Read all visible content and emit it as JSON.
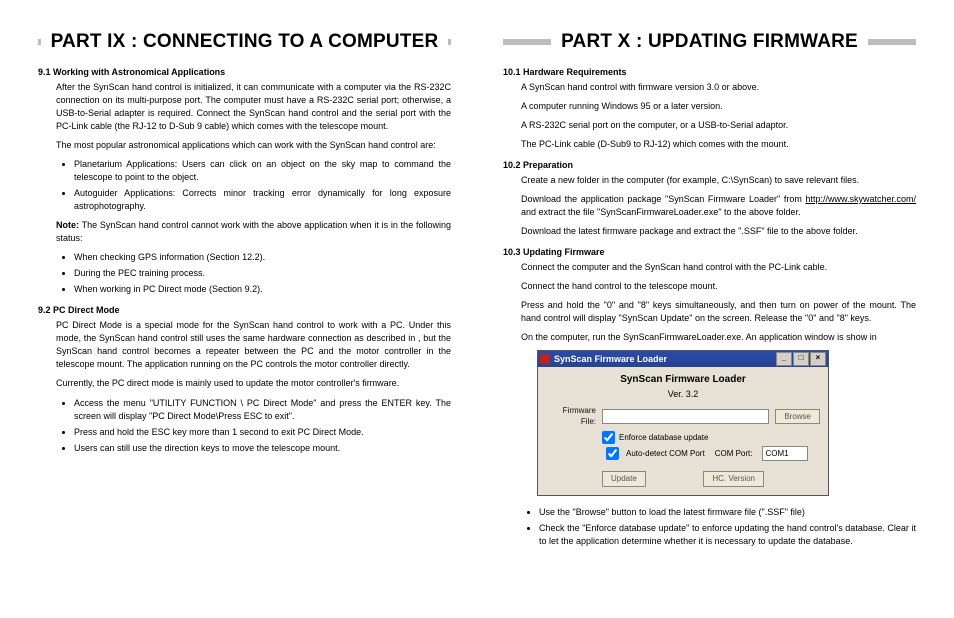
{
  "left": {
    "part_title": "PART IX : CONNECTING TO A COMPUTER",
    "s91_head": "9.1 Working with Astronomical Applications",
    "s91_p1": "After the SynScan hand control is initialized, it can communicate with a computer via the RS-232C connection on its multi-purpose port. The computer must have a RS-232C serial port; otherwise, a USB-to-Serial adapter is required. Connect the SynScan hand control and the serial port with the PC-Link cable (the RJ-12 to D-Sub 9 cable) which comes with the telescope mount.",
    "s91_p2": "The most popular astronomical applications which can work with the SynScan hand control are:",
    "s91_b1": "Planetarium Applications: Users can click on an object on the sky map to command the telescope to point to the object.",
    "s91_b2": "Autoguider Applications: Corrects minor tracking error dynamically for long exposure astrophotography.",
    "s91_note_label": "Note:",
    "s91_note": " The SynScan hand control cannot work with the above application when it is in the following status:",
    "s91_n1": "When checking GPS information (Section 12.2).",
    "s91_n2": "During the PEC training process.",
    "s91_n3": "When working in PC Direct mode (Section 9.2).",
    "s92_head": "9.2 PC Direct Mode",
    "s92_p1_a": "PC Direct Mode is a special mode for the SynScan hand control to work with a PC. Under this mode, the SynScan hand control still uses the same hardware connection as described in ",
    "s92_p1_b": ", but the SynScan hand control becomes a repeater between the PC and the motor controller in the telescope mount. The application running on the PC controls the motor controller directly.",
    "s92_p2": "Currently, the PC direct mode is mainly used to update the motor controller's firmware.",
    "s92_b1_a": "Access the menu \"",
    "s92_b1_path": "UTILITY FUNCTION \\ PC Direct Mode",
    "s92_b1_b": "\" and press the ",
    "s92_b1_enter": "ENTER",
    "s92_b1_c": " key. The screen will display \"",
    "s92_b1_msg": "PC Direct Mode\\Press ESC to exit",
    "s92_b1_d": "\".",
    "s92_b2_a": "Press and hold the ",
    "s92_b2_esc": "ESC",
    "s92_b2_b": " key more than 1 second to exit ",
    "s92_b2_mode": "PC Direct Mode",
    "s92_b2_c": ".",
    "s92_b3": "Users can still use the direction keys to move the telescope mount."
  },
  "right": {
    "part_title": "PART X : UPDATING FIRMWARE",
    "s101_head": "10.1 Hardware Requirements",
    "s101_l1": "A SynScan hand control with firmware version 3.0 or above.",
    "s101_l2": "A computer running Windows 95 or a later version.",
    "s101_l3": "A RS-232C serial port on the computer, or a USB-to-Serial adaptor.",
    "s101_l4": "The PC-Link cable (D-Sub9 to RJ-12) which comes with the mount.",
    "s102_head": "10.2 Preparation",
    "s102_l1_a": "Create a new folder in the computer (for example, ",
    "s102_l1_path": "C:\\SynScan",
    "s102_l1_b": ") to save relevant files.",
    "s102_l2_a": "Download the application package \"",
    "s102_l2_pkg": "SynScan Firmware Loader",
    "s102_l2_b": "\" from ",
    "s102_l2_url": "http://www.skywatcher.com/",
    "s102_l2_c": " and extract the file \"",
    "s102_l2_exe": "SynScanFirmwareLoader.exe",
    "s102_l2_d": "\" to the above folder.",
    "s102_l3_a": "Download the latest firmware package and extract the \".",
    "s102_l3_ssf": "SSF",
    "s102_l3_b": "\" file to the above folder.",
    "s103_head": "10.3 Updating Firmware",
    "s103_l1": "Connect the computer and the SynScan hand control with the PC-Link cable.",
    "s103_l2": "Connect the hand control to the telescope mount.",
    "s103_l3_a": "Press and hold the \"",
    "s103_l3_0": "0",
    "s103_l3_b": "\" and \"",
    "s103_l3_8": "8",
    "s103_l3_c": "\" keys simultaneously, and then turn on power of the mount. The hand control will display \"",
    "s103_l3_upd": "SynScan Update",
    "s103_l3_d": "\" on the screen. Release the \"",
    "s103_l3_e": "\" and \"",
    "s103_l3_f": "\" keys.",
    "s103_l4_a": "On the computer, run the ",
    "s103_l4_exe": "SynScanFirmwareLoader.exe",
    "s103_l4_b": ". An application window is show in",
    "screenshot": {
      "title": "SynScan Firmware Loader",
      "app_title": "SynScan Firmware Loader",
      "version": "Ver. 3.2",
      "file_label": "Firmware File:",
      "browse": "Browse",
      "chk1": "Enforce database update",
      "chk2": "Auto-detect COM Port",
      "com_label": "COM Port:",
      "com_value": "COM1",
      "update": "Update",
      "hc": "HC. Version",
      "min": "_",
      "max": "□",
      "close": "×"
    },
    "s103_b1_a": "Use the \"",
    "s103_b1_browse": "Browse",
    "s103_b1_b": "\" button to load the latest firmware file (\".",
    "s103_b1_ssf": "SSF",
    "s103_b1_c": "\" file)",
    "s103_b2_a": "Check the \"",
    "s103_b2_opt": "Enforce database update",
    "s103_b2_b": "\" to enforce updating the hand control's database. Clear it to let the application determine whether it is necessary to update the database."
  }
}
